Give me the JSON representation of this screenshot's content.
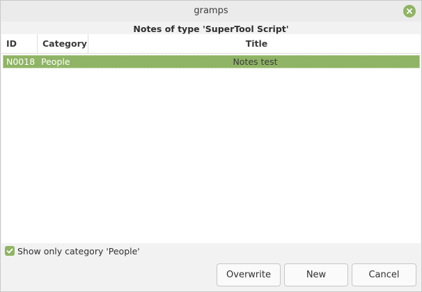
{
  "window": {
    "title": "gramps",
    "close_icon": "close-icon"
  },
  "dialog": {
    "subtitle": "Notes of type 'SuperTool Script'"
  },
  "table": {
    "columns": [
      "ID",
      "Category",
      "Title"
    ],
    "rows": [
      {
        "id": "N0018",
        "category": "People",
        "title": "Notes test",
        "selected": true
      }
    ]
  },
  "filter": {
    "checked": true,
    "label": "Show only category 'People'"
  },
  "buttons": {
    "overwrite": "Overwrite",
    "new": "New",
    "cancel": "Cancel"
  },
  "colors": {
    "accent": "#8fb465",
    "background": "#f2f2f2",
    "list_background": "#ffffff"
  }
}
